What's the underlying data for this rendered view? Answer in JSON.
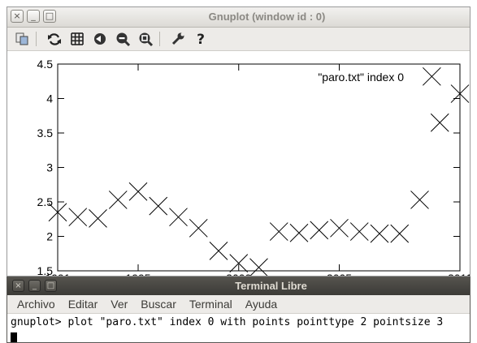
{
  "gnuplot_window": {
    "title": "Gnuplot (window id : 0)",
    "controls": {
      "close": "×",
      "minimize": "_",
      "maximize": "□"
    },
    "toolbar": [
      {
        "name": "copy-to-clipboard-icon"
      },
      {
        "name": "replot-icon"
      },
      {
        "name": "grid-icon"
      },
      {
        "name": "previous-zoom-icon"
      },
      {
        "name": "next-zoom-icon"
      },
      {
        "name": "autoscale-icon"
      },
      {
        "name": "settings-wrench-icon"
      },
      {
        "name": "help-icon"
      }
    ]
  },
  "chart_data": {
    "type": "scatter",
    "legend": "\"paro.txt\" index 0",
    "legend_position": "top-right",
    "grid": false,
    "marker": "cross",
    "xlim": [
      1991,
      2011
    ],
    "ylim": [
      1.5,
      4.5
    ],
    "yticks": [
      "1.5",
      "2",
      "2.5",
      "3",
      "3.5",
      "4",
      "4.5"
    ],
    "xticks": [
      "1991",
      "1995",
      "2000",
      "2005",
      "2011"
    ],
    "series": [
      {
        "x": [
          1991,
          1992,
          1993,
          1994,
          1995,
          1996,
          1997,
          1998,
          1999,
          2000,
          2001,
          2002,
          2003,
          2004,
          2005,
          2006,
          2007,
          2008,
          2009,
          2010,
          2011
        ],
        "y": [
          2.35,
          2.28,
          2.26,
          2.53,
          2.65,
          2.44,
          2.28,
          2.12,
          1.79,
          1.61,
          1.55,
          2.07,
          2.05,
          2.09,
          2.12,
          2.07,
          2.04,
          2.04,
          2.53,
          3.65,
          4.07
        ]
      },
      {
        "x": [
          1987.8,
          2009.6
        ],
        "y": [
          4.32,
          4.32
        ]
      }
    ]
  },
  "terminal": {
    "title": "Terminal Libre",
    "controls": {
      "close": "×",
      "minimize": "_",
      "maximize": "□"
    },
    "menu": [
      "Archivo",
      "Editar",
      "Ver",
      "Buscar",
      "Terminal",
      "Ayuda"
    ],
    "prompt": "gnuplot> ",
    "command": "plot \"paro.txt\" index 0 with points pointtype 2 pointsize 3"
  }
}
